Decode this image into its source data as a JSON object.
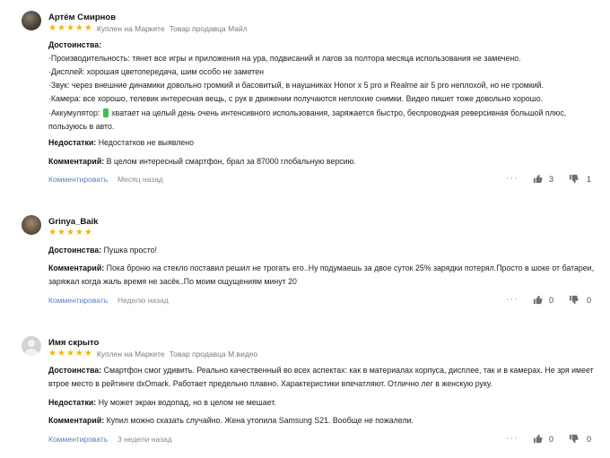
{
  "reviews": [
    {
      "author": "Артём Смирнов",
      "rating": 5,
      "meta": [
        "Куплен на Маркете",
        "Товар продавца Майл"
      ],
      "pros_label": "Достоинства:",
      "pros_lines": [
        "·Производительность: тянет все игры и приложения на ура, подвисаний и лагов за полтора месяца использования не замечено.",
        "·Дисплей: хорошая цветопередача, шим особо не заметен",
        "·Звук: через внешние динамики довольно громкий и басовитый, в наушниках Honor x 5 pro и Realme air 5 pro неплохой, но не громкий.",
        "·Камера: все хорошо, телевик интересная вещь, с рук в движении получаются неплохие снимки. Видео пишет тоже довольно хорошо.",
        "хватает на целый день очень интенсивного использования, заряжается быстро, беспроводная реверсивная большой плюс,",
        "пользуюсь в авто."
      ],
      "battery_prefix": "·Аккумулятор:",
      "cons_label": "Недостатки:",
      "cons": "Недостатков не выявлено",
      "comment_label": "Комментарий:",
      "comment": "В целом интересный смартфон, брал за 87000 глобальную версию.",
      "comment_action": "Комментировать",
      "time": "Месяц назад",
      "likes": "3",
      "dislikes": "1"
    },
    {
      "author": "Grinya_Baik",
      "rating": 5,
      "pros_label": "Достоинства:",
      "pros": "Пушка просто!",
      "comment_label": "Комментарий:",
      "comment_lines": [
        "Пока броню на стекло поставил решил не трогать его..Ну подумаешь за двое суток 25% зарядки потерял.Просто в шоке от батареи,",
        "заряжал когда жаль время не засёк..По моим ощущениям минут 20"
      ],
      "comment_action": "Комментировать",
      "time": "Неделю назад",
      "likes": "0",
      "dislikes": "0"
    },
    {
      "author": "Имя скрыто",
      "rating": 5,
      "meta": [
        "Куплен на Маркете",
        "Товар продавца М.видео"
      ],
      "pros_label": "Достоинства:",
      "pros_lines": [
        "Смартфон смог удивить. Реально качественный во всех аспектах: как в материалах корпуса, дисплее, так и в камерах. Не зря имеет",
        "втрое место в рейтинге dxOmark. Работает предельно плавно. Характеристики впечатляют. Отлично лег в женскую руку."
      ],
      "cons_label": "Недостатки:",
      "cons": "Ну может экран водопад, но в целом не мешает.",
      "comment_label": "Комментарий:",
      "comment": "Купил можно сказать случайно. Жена утопила Samsung S21. Вообще не пожалели.",
      "comment_action": "Комментировать",
      "time": "3 недели назад",
      "likes": "0",
      "dislikes": "0"
    }
  ],
  "colors": {
    "star": "#f6b606",
    "link": "#5a7fbf",
    "battery": "#3dbf54"
  },
  "icons": {
    "more": "more-dots-icon",
    "like": "thumb-up-icon",
    "dislike": "thumb-down-icon"
  }
}
